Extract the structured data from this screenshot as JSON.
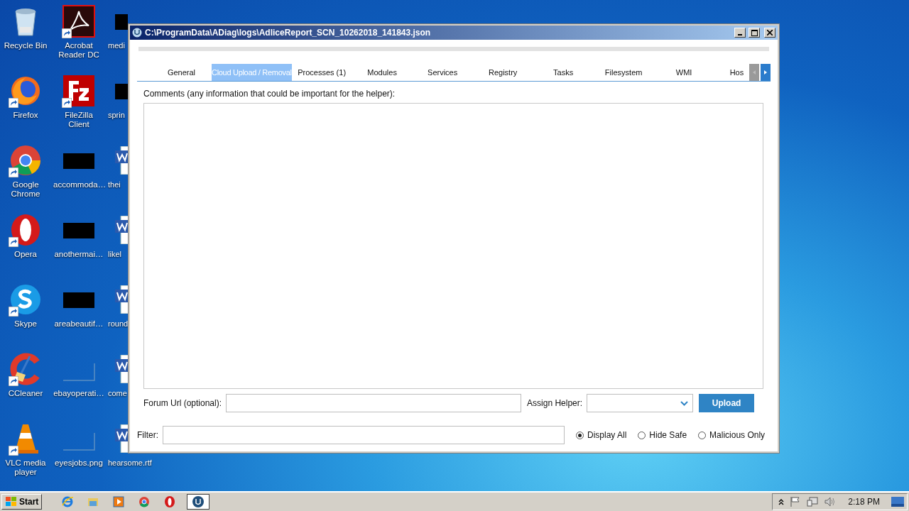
{
  "desktop": {
    "columns": [
      [
        {
          "label": "Recycle Bin",
          "kind": "recycle",
          "shortcut": false
        },
        {
          "label": "Firefox",
          "kind": "firefox",
          "shortcut": true
        },
        {
          "label": "Google Chrome",
          "kind": "chrome",
          "shortcut": true
        },
        {
          "label": "Opera",
          "kind": "opera",
          "shortcut": true
        },
        {
          "label": "Skype",
          "kind": "skype",
          "shortcut": true
        },
        {
          "label": "CCleaner",
          "kind": "ccleaner",
          "shortcut": true
        },
        {
          "label": "VLC media player",
          "kind": "vlc",
          "shortcut": true
        }
      ],
      [
        {
          "label": "Acrobat Reader DC",
          "kind": "acrobat",
          "shortcut": true
        },
        {
          "label": "FileZilla Client",
          "kind": "filezilla",
          "shortcut": true
        },
        {
          "label": "accommoda…",
          "kind": "redacted",
          "shortcut": false
        },
        {
          "label": "anothermai…",
          "kind": "redacted",
          "shortcut": false
        },
        {
          "label": "areabeautif…",
          "kind": "redacted",
          "shortcut": false
        },
        {
          "label": "ebayoperati…",
          "kind": "thumbnail",
          "shortcut": false
        },
        {
          "label": "eyesjobs.png",
          "kind": "thumbnail",
          "shortcut": false
        }
      ],
      [
        {
          "label": "medi",
          "kind": "redacted",
          "shortcut": false
        },
        {
          "label": "sprin",
          "kind": "redacted",
          "shortcut": false
        },
        {
          "label": "thei",
          "kind": "document",
          "shortcut": false
        },
        {
          "label": "likel",
          "kind": "document",
          "shortcut": false
        },
        {
          "label": "round",
          "kind": "document",
          "shortcut": false
        },
        {
          "label": "come",
          "kind": "document",
          "shortcut": false
        },
        {
          "label": "hearsome.rtf",
          "kind": "document",
          "shortcut": false
        }
      ]
    ]
  },
  "window": {
    "title": "C:\\ProgramData\\ADiag\\logs\\AdliceReport_SCN_10262018_141843.json",
    "tabs": [
      {
        "label": "General",
        "selected": false
      },
      {
        "label": "Cloud Upload / Removal",
        "selected": true
      },
      {
        "label": "Processes (1)",
        "selected": false
      },
      {
        "label": "Modules",
        "selected": false
      },
      {
        "label": "Services",
        "selected": false
      },
      {
        "label": "Registry",
        "selected": false
      },
      {
        "label": "Tasks",
        "selected": false
      },
      {
        "label": "Filesystem",
        "selected": false
      },
      {
        "label": "WMI",
        "selected": false
      },
      {
        "label": "Hos",
        "selected": false
      }
    ],
    "comments_label": "Comments (any information that could be important for the helper):",
    "forum_label": "Forum Url (optional):",
    "assign_label": "Assign Helper:",
    "upload_button": "Upload",
    "filter_label": "Filter:",
    "filter_options": [
      {
        "label": "Display All",
        "selected": true
      },
      {
        "label": "Hide Safe",
        "selected": false
      },
      {
        "label": "Malicious Only",
        "selected": false
      }
    ]
  },
  "taskbar": {
    "start": "Start",
    "apps": [
      {
        "kind": "ie",
        "active": false
      },
      {
        "kind": "explorer",
        "active": false
      },
      {
        "kind": "media",
        "active": false
      },
      {
        "kind": "chrome",
        "active": false
      },
      {
        "kind": "opera",
        "active": false
      },
      {
        "kind": "adlice",
        "active": true
      }
    ],
    "time": "2:18 PM"
  }
}
